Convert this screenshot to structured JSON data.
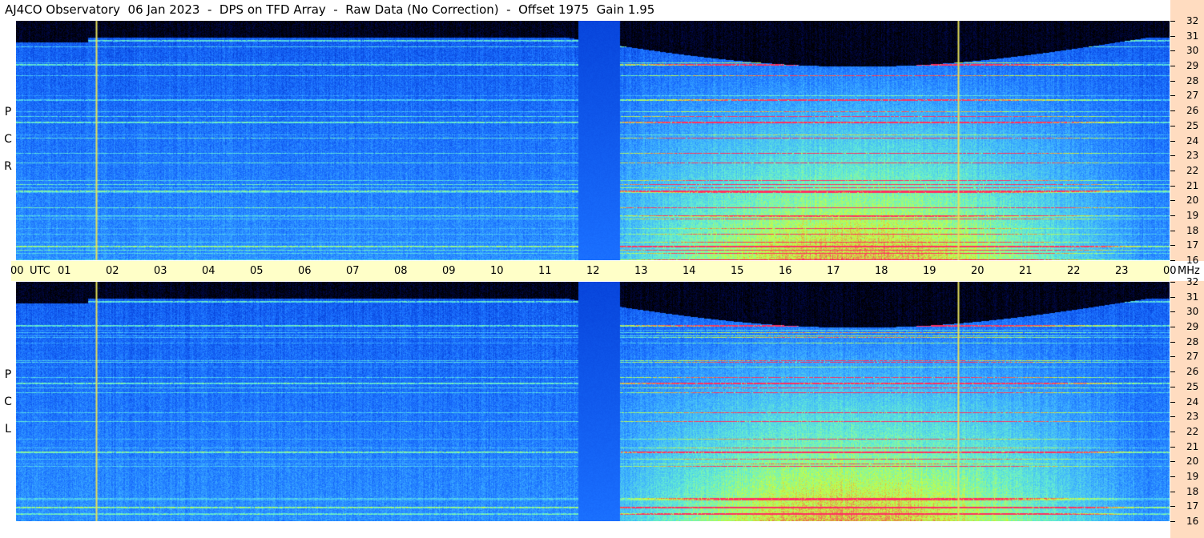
{
  "header": {
    "title": "AJ4CO Observatory  06 Jan 2023  -  DPS on TFD Array  -  Raw Data (No Correction)  -  Offset 1975  Gain 1.95"
  },
  "chart_data": [
    {
      "type": "heatmap",
      "panel": "RCP",
      "label_letters": [
        "R",
        "C",
        "P"
      ],
      "x_unit": "UTC",
      "y_unit": "MHz",
      "x_range_hours": [
        0,
        24
      ],
      "y_range_mhz": [
        16,
        32
      ],
      "colormap": [
        "#000000",
        "#000a5a",
        "#0033cc",
        "#1a6fff",
        "#3fb4ff",
        "#66f0d0",
        "#c8ff40",
        "#ff3060"
      ],
      "calibration_band_utc": [
        11.7,
        12.55
      ],
      "vertical_markers_utc": [
        1.67,
        19.6
      ],
      "noise_floor_note": ""
    },
    {
      "type": "heatmap",
      "panel": "LCP",
      "label_letters": [
        "L",
        "C",
        "P"
      ],
      "x_unit": "UTC",
      "y_unit": "MHz",
      "x_range_hours": [
        0,
        24
      ],
      "y_range_mhz": [
        16,
        32
      ],
      "colormap": [
        "#000000",
        "#000a5a",
        "#0033cc",
        "#1a6fff",
        "#3fb4ff",
        "#66f0d0",
        "#c8ff40",
        "#ff3060"
      ],
      "calibration_band_utc": [
        11.7,
        12.55
      ],
      "vertical_markers_utc": [
        1.67,
        19.6
      ]
    }
  ],
  "x_axis": {
    "tick_labels": [
      "00",
      "01",
      "02",
      "03",
      "04",
      "05",
      "06",
      "07",
      "08",
      "09",
      "10",
      "11",
      "12",
      "13",
      "14",
      "15",
      "16",
      "17",
      "18",
      "19",
      "20",
      "21",
      "22",
      "23",
      "00"
    ],
    "unit_label": "UTC",
    "right_unit_label": "MHz"
  },
  "y_axis": {
    "tick_labels": [
      "32",
      "31",
      "30",
      "29",
      "28",
      "27",
      "26",
      "25",
      "24",
      "23",
      "22",
      "21",
      "20",
      "19",
      "18",
      "17",
      "16"
    ]
  }
}
